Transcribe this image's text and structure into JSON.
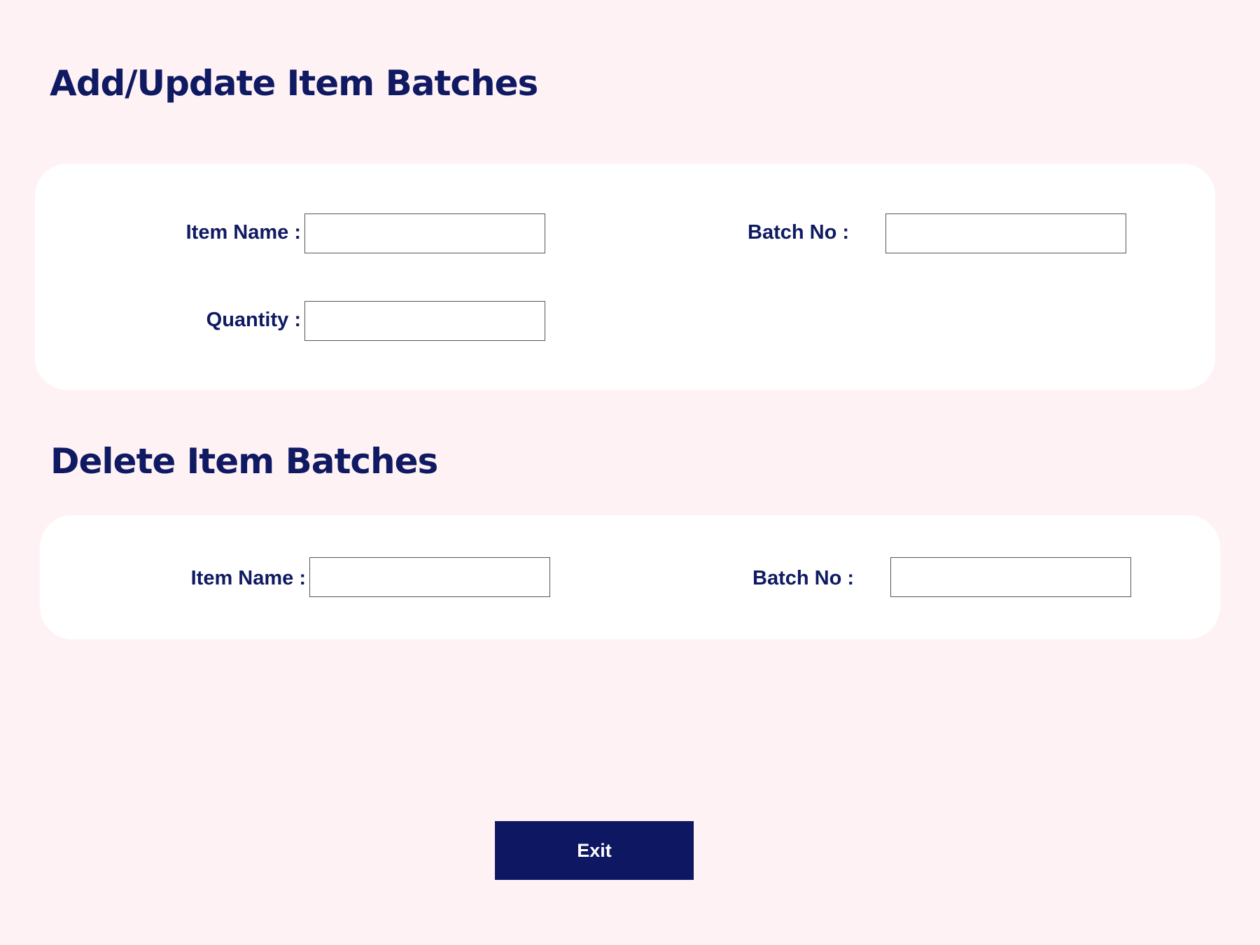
{
  "add_update_section": {
    "title": "Add/Update Item Batches",
    "item_name_label": "Item Name :",
    "item_name_value": "",
    "batch_no_label": "Batch No :",
    "batch_no_value": "",
    "quantity_label": "Quantity :",
    "quantity_value": ""
  },
  "delete_section": {
    "title": "Delete Item Batches",
    "item_name_label": "Item Name :",
    "item_name_value": "",
    "batch_no_label": "Batch No  :",
    "batch_no_value": ""
  },
  "actions": {
    "exit_label": "Exit"
  },
  "colors": {
    "background": "#fff2f5",
    "card": "#ffffff",
    "accent": "#0f1a63",
    "button": "#0d1762"
  }
}
